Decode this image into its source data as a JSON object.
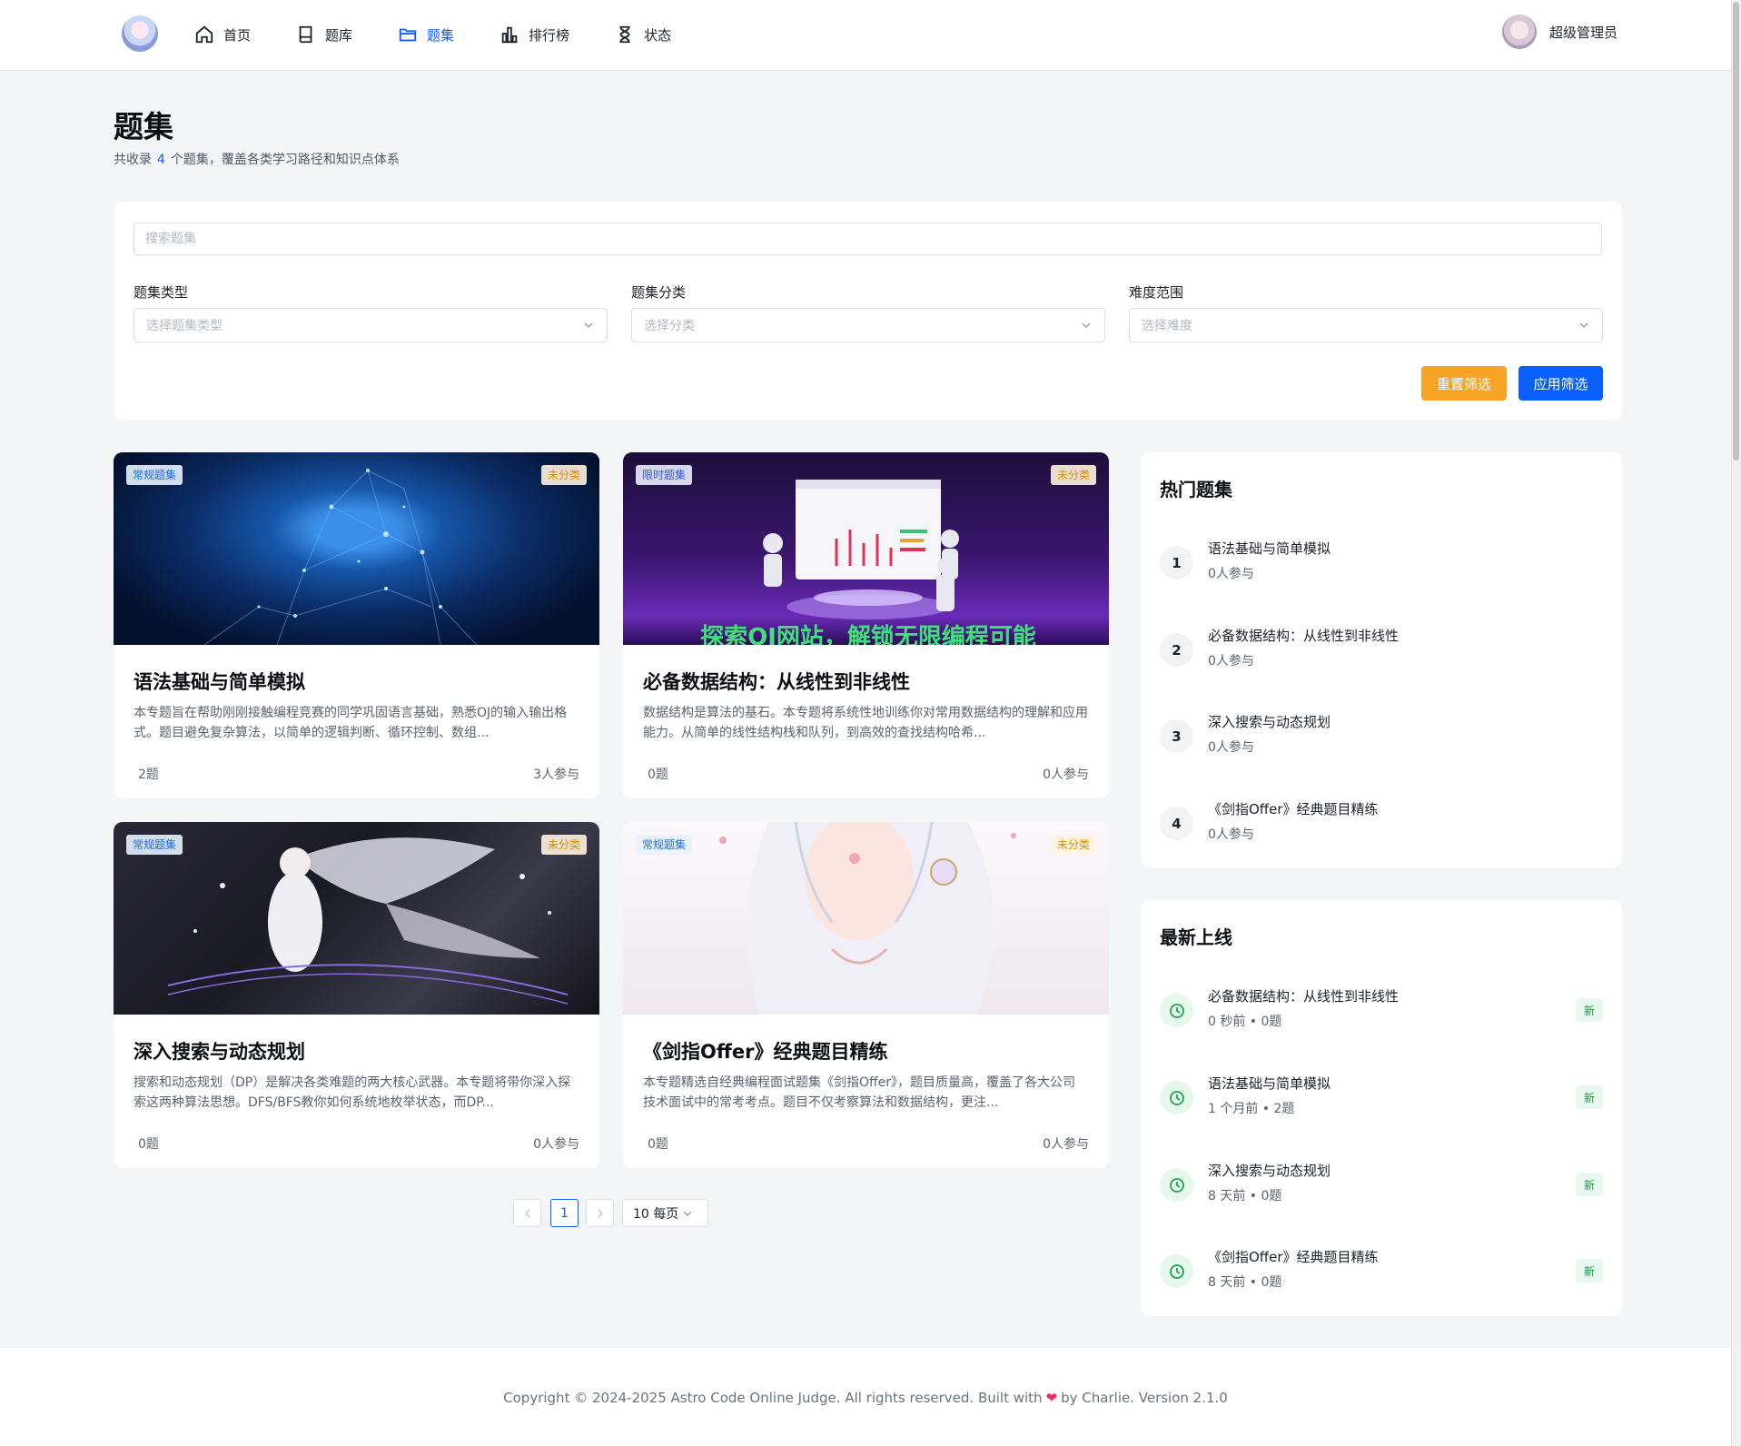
{
  "nav": {
    "items": [
      {
        "label": "首页",
        "icon": "home-icon"
      },
      {
        "label": "题库",
        "icon": "book-icon"
      },
      {
        "label": "题集",
        "icon": "folder-icon",
        "active": true
      },
      {
        "label": "排行榜",
        "icon": "bar-chart-icon"
      },
      {
        "label": "状态",
        "icon": "hourglass-icon"
      }
    ],
    "username": "超级管理员"
  },
  "page": {
    "title": "题集",
    "subtitle_prefix": "共收录",
    "subtitle_count": "4",
    "subtitle_suffix": "个题集，覆盖各类学习路径和知识点体系"
  },
  "filters": {
    "search_placeholder": "搜索题集",
    "type_label": "题集类型",
    "type_placeholder": "选择题集类型",
    "category_label": "题集分类",
    "category_placeholder": "选择分类",
    "difficulty_label": "难度范围",
    "difficulty_placeholder": "选择难度",
    "reset_label": "重置筛选",
    "apply_label": "应用筛选"
  },
  "problem_sets": [
    {
      "type_tag": "常规题集",
      "category_tag": "未分类",
      "title": "语法基础与简单模拟",
      "description": "本专题旨在帮助刚刚接触编程竞赛的同学巩固语言基础，熟悉OJ的输入输出格式。题目避免复杂算法，以简单的逻辑判断、循环控制、数组...",
      "count": "2题",
      "joined": "3人参与"
    },
    {
      "type_tag": "限时题集",
      "category_tag": "未分类",
      "title": "必备数据结构：从线性到非线性",
      "description": "数据结构是算法的基石。本专题将系统性地训练你对常用数据结构的理解和应用能力。从简单的线性结构栈和队列，到高效的查找结构哈希...",
      "count": "0题",
      "joined": "0人参与"
    },
    {
      "type_tag": "常规题集",
      "category_tag": "未分类",
      "title": "深入搜索与动态规划",
      "description": "搜索和动态规划（DP）是解决各类难题的两大核心武器。本专题将带你深入探索这两种算法思想。DFS/BFS教你如何系统地枚举状态，而DP...",
      "count": "0题",
      "joined": "0人参与"
    },
    {
      "type_tag": "常规题集",
      "category_tag": "未分类",
      "title": "《剑指Offer》经典题目精练",
      "description": "本专题精选自经典编程面试题集《剑指Offer》，题目质量高，覆盖了各大公司技术面试中的常考考点。题目不仅考察算法和数据结构，更注...",
      "count": "0题",
      "joined": "0人参与"
    }
  ],
  "pagination": {
    "current": "1",
    "page_size": "10 每页"
  },
  "hot": {
    "title": "热门题集",
    "items": [
      {
        "rank": "1",
        "name": "语法基础与简单模拟",
        "meta": "0人参与"
      },
      {
        "rank": "2",
        "name": "必备数据结构：从线性到非线性",
        "meta": "0人参与"
      },
      {
        "rank": "3",
        "name": "深入搜索与动态规划",
        "meta": "0人参与"
      },
      {
        "rank": "4",
        "name": "《剑指Offer》经典题目精练",
        "meta": "0人参与"
      }
    ]
  },
  "latest": {
    "title": "最新上线",
    "badge": "新",
    "items": [
      {
        "name": "必备数据结构：从线性到非线性",
        "meta": "0 秒前 • 0题"
      },
      {
        "name": "语法基础与简单模拟",
        "meta": "1 个月前 • 2题"
      },
      {
        "name": "深入搜索与动态规划",
        "meta": "8 天前 • 0题"
      },
      {
        "name": "《剑指Offer》经典题目精练",
        "meta": "8 天前 • 0题"
      }
    ]
  },
  "footer": {
    "text_before": "Copyright © 2024-2025 Astro Code Online Judge. All rights reserved. Built with",
    "heart": "❤",
    "text_after": "by Charlie. Version 2.1.0"
  },
  "colors": {
    "primary": "#165dff",
    "reset_button": "#f7a324",
    "apply_button": "#0a60ff",
    "new_badge": "#10a14a"
  }
}
